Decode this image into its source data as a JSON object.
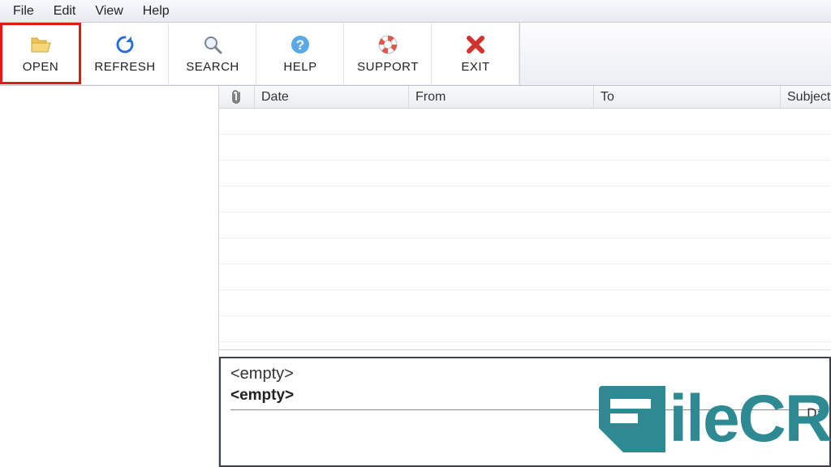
{
  "menubar": [
    "File",
    "Edit",
    "View",
    "Help"
  ],
  "toolbar": [
    {
      "id": "open",
      "label": "OPEN",
      "highlight": true
    },
    {
      "id": "refresh",
      "label": "REFRESH",
      "highlight": false
    },
    {
      "id": "search",
      "label": "SEARCH",
      "highlight": false
    },
    {
      "id": "help",
      "label": "HELP",
      "highlight": false
    },
    {
      "id": "support",
      "label": "SUPPORT",
      "highlight": false
    },
    {
      "id": "exit",
      "label": "EXIT",
      "highlight": false
    }
  ],
  "columns": {
    "attachment_aria": "Attachment",
    "date": "Date",
    "from": "From",
    "to": "To",
    "subject": "Subject"
  },
  "preview": {
    "line1": "<empty>",
    "line2": "<empty>",
    "date_label": "Da"
  },
  "watermark": {
    "text": "ileCR"
  },
  "colors": {
    "highlight_border": "#e41818",
    "accent": "#2d8a92"
  }
}
